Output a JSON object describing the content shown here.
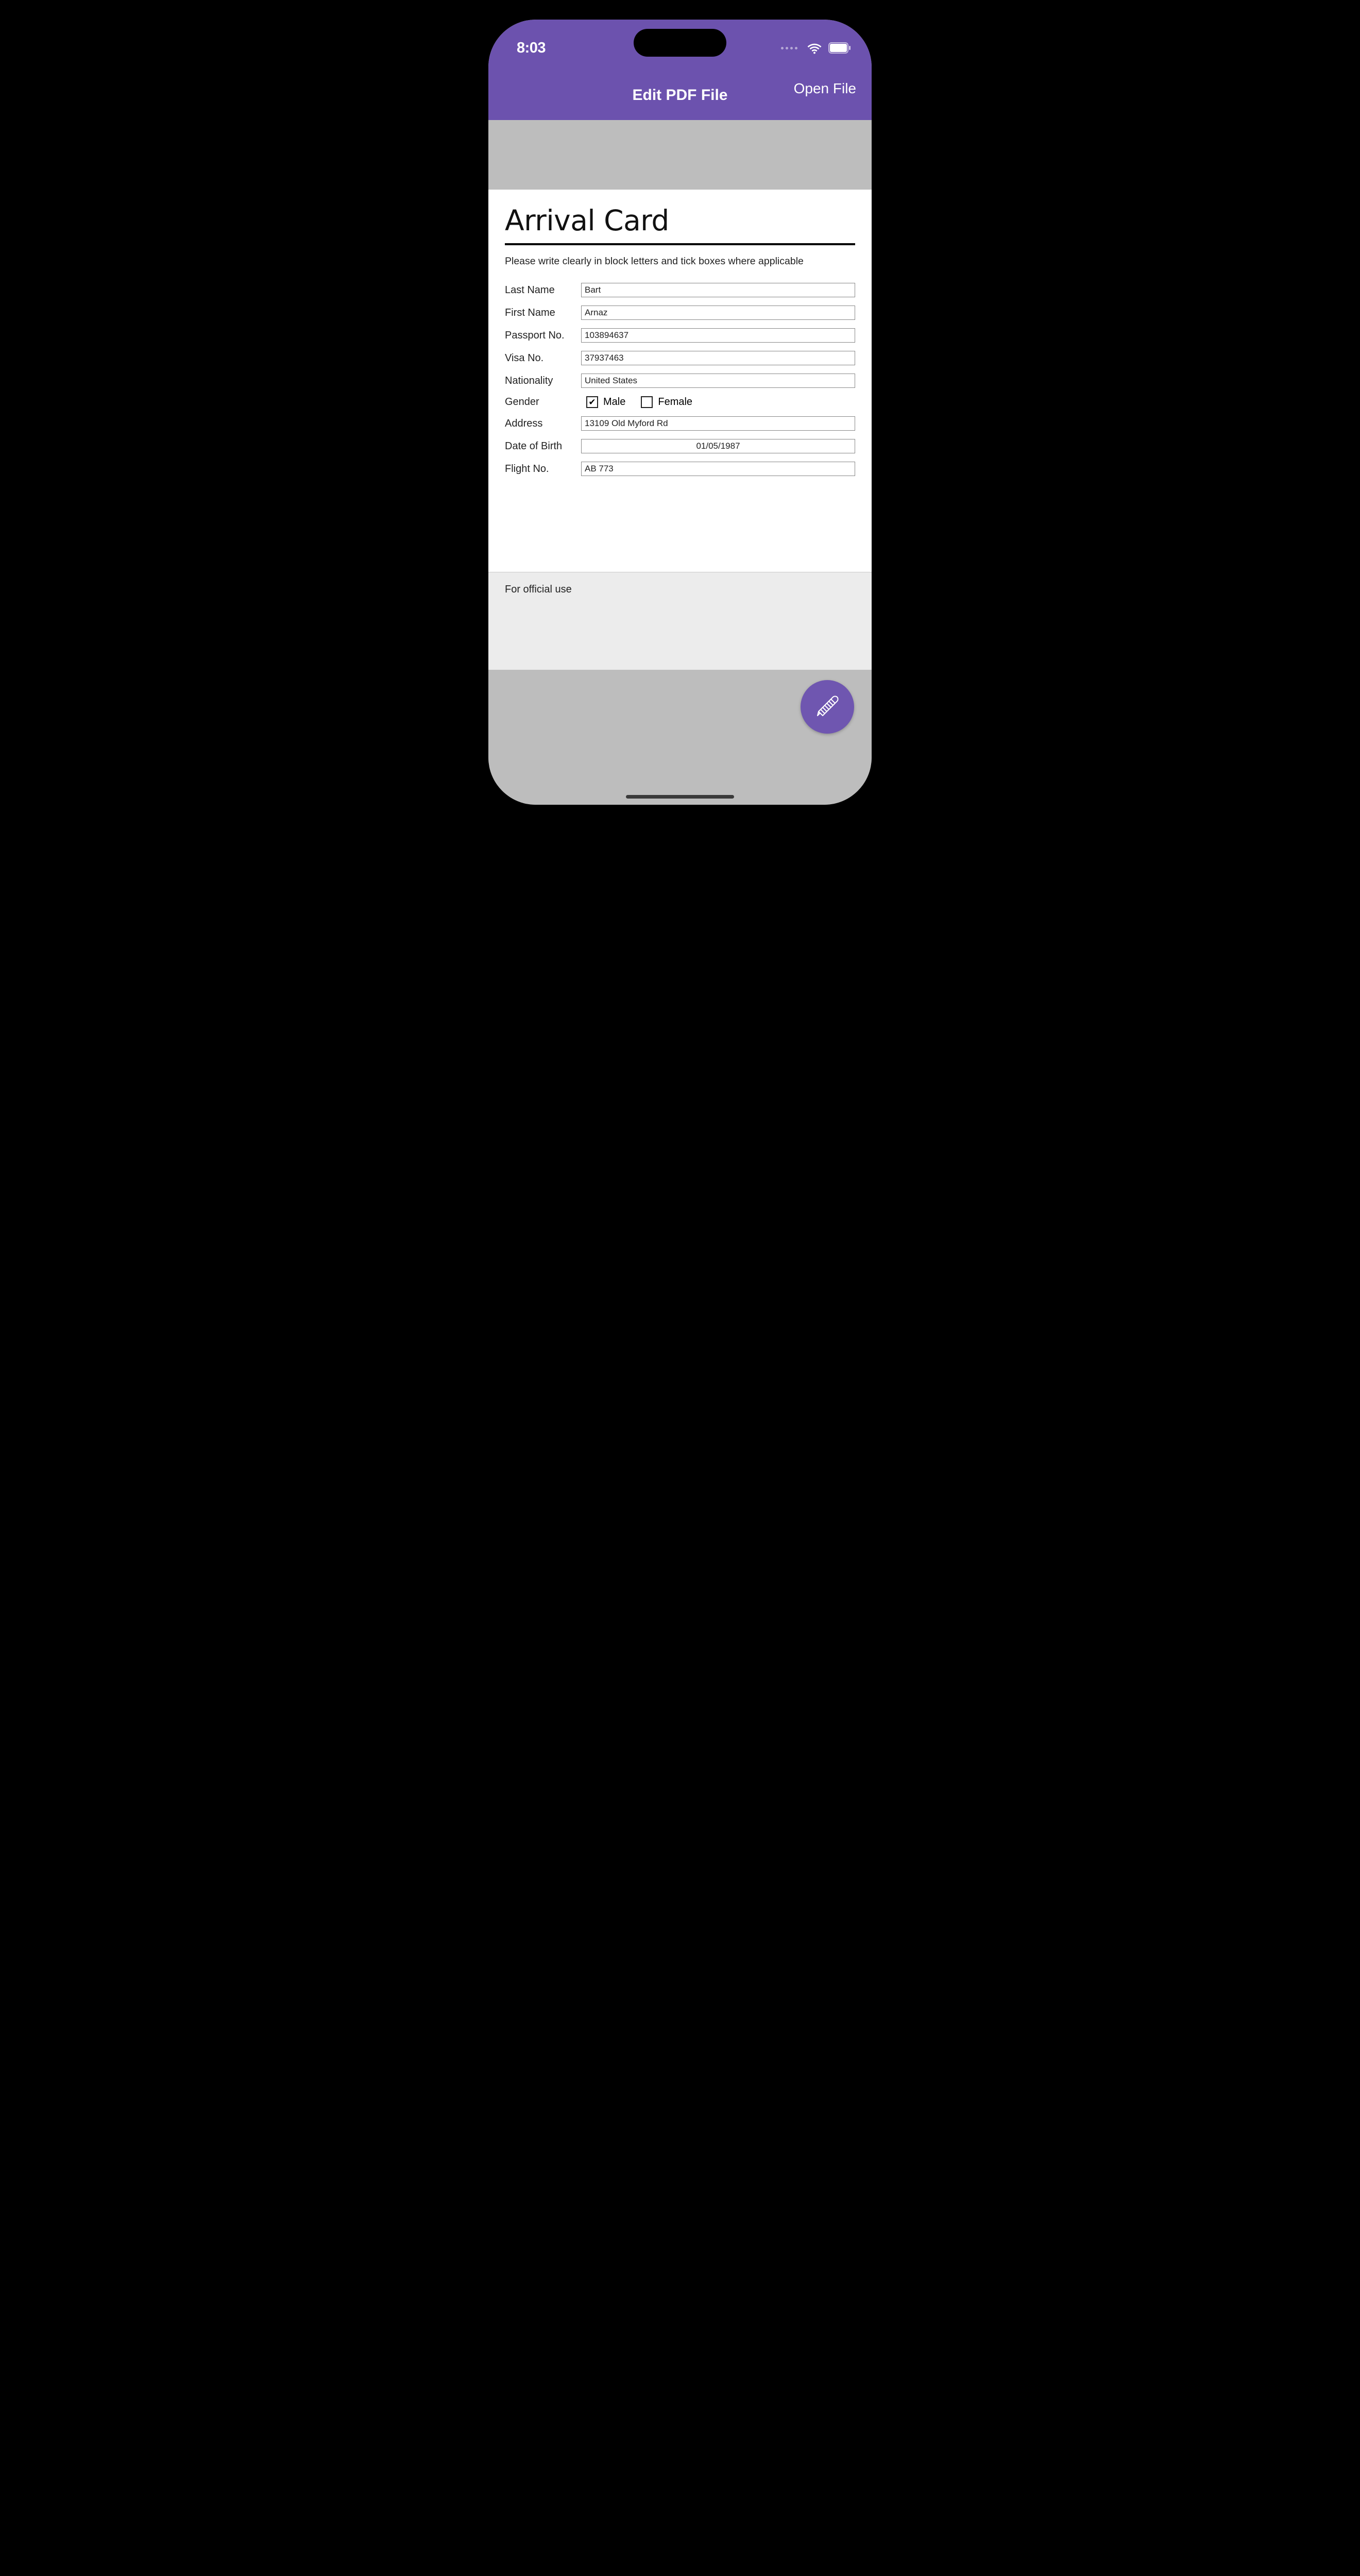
{
  "statusbar": {
    "time": "8:03"
  },
  "nav": {
    "title": "Edit PDF File",
    "open_file": "Open File"
  },
  "doc": {
    "title": "Arrival Card",
    "instruction": "Please write clearly in block letters and tick boxes where applicable",
    "labels": {
      "last_name": "Last Name",
      "first_name": "First Name",
      "passport_no": "Passport No.",
      "visa_no": "Visa No.",
      "nationality": "Nationality",
      "gender": "Gender",
      "male": "Male",
      "female": "Female",
      "address": "Address",
      "dob": "Date of Birth",
      "flight_no": "Flight No."
    },
    "values": {
      "last_name": "Bart",
      "first_name": "Arnaz",
      "passport_no": "103894637",
      "visa_no": "37937463",
      "nationality": "United States",
      "gender_male_checked": "✔",
      "gender_female_checked": "",
      "address": "13109 Old Myford Rd",
      "dob": "01/05/1987",
      "flight_no": "AB 773"
    },
    "official_use": "For official use"
  }
}
